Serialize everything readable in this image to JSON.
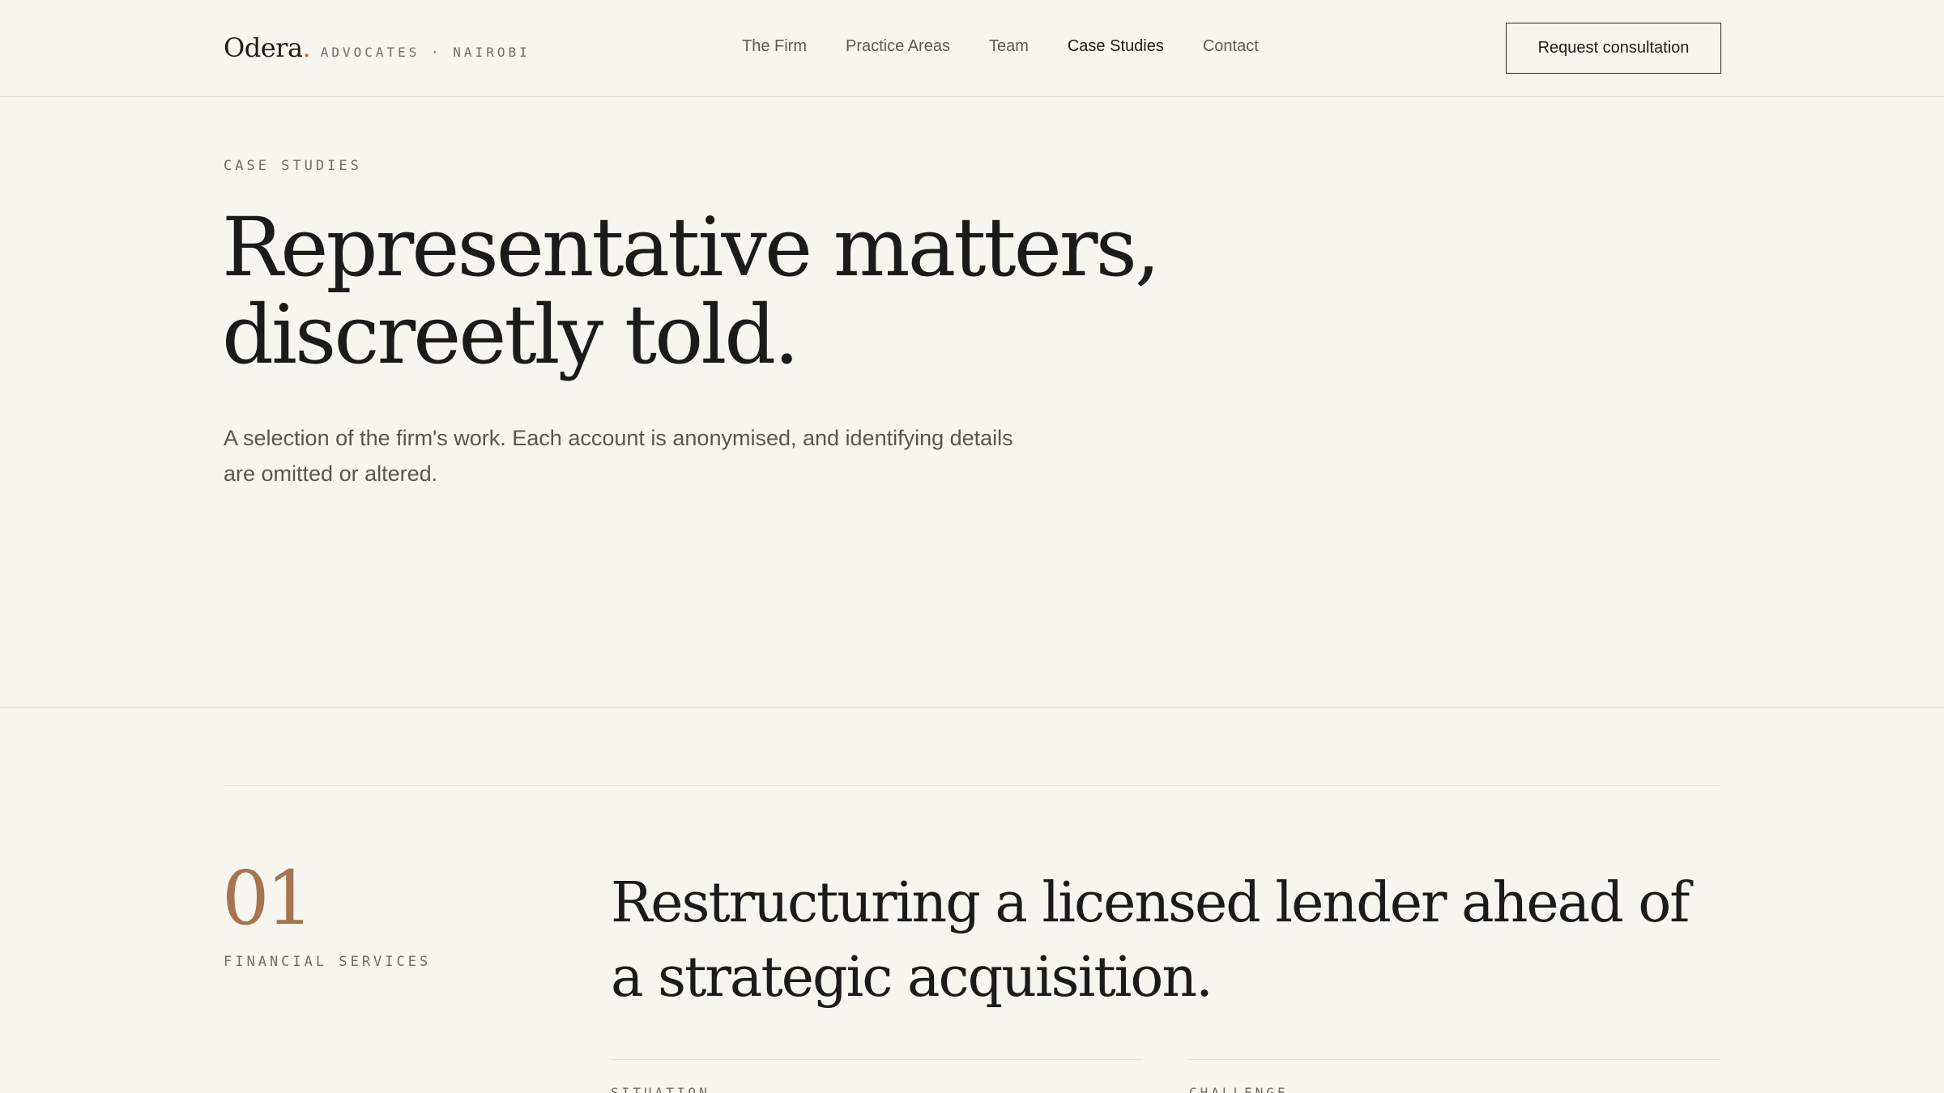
{
  "header": {
    "brand_name": "Odera",
    "brand_dot": ".",
    "brand_tagline": "ADVOCATES · NAIROBI",
    "nav": [
      {
        "label": "The Firm"
      },
      {
        "label": "Practice Areas"
      },
      {
        "label": "Team"
      },
      {
        "label": "Case Studies"
      },
      {
        "label": "Contact"
      }
    ],
    "active_nav": "Case Studies",
    "cta_label": "Request consultation"
  },
  "hero": {
    "eyebrow": "CASE STUDIES",
    "title_line1": "Representative matters,",
    "title_line2": "discreetly told.",
    "lede": "A selection of the firm's work. Each account is anonymised, and identifying details are omitted or altered."
  },
  "case": {
    "number": "01",
    "sector": "FINANCIAL SERVICES",
    "title": "Restructuring a licensed lender ahead of a strategic acquisition.",
    "left_label": "SITUATION",
    "right_label": "CHALLENGE"
  },
  "colors": {
    "background": "#f7f5ef",
    "accent": "#a6744f",
    "text": "#1b1b1b",
    "muted": "#6f6c66"
  }
}
